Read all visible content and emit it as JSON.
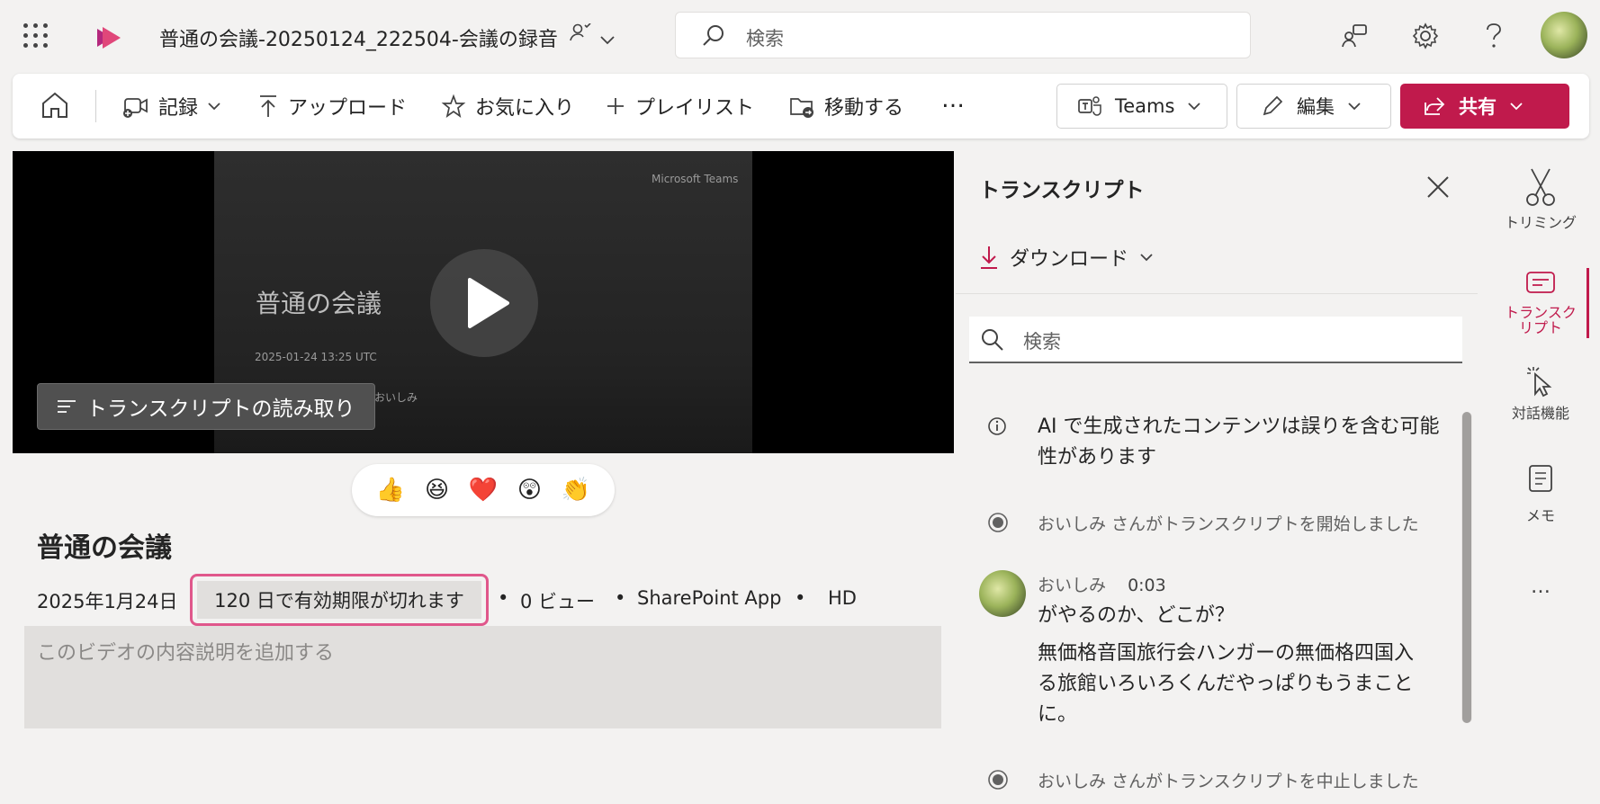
{
  "app": {
    "title": "普通の会議-20250124_222504-会議の録音",
    "search_placeholder": "検索",
    "brand_color": "#c01a4c"
  },
  "toolbar": {
    "record": "記録",
    "upload": "アップロード",
    "favorite": "お気に入り",
    "playlist": "プレイリスト",
    "move": "移動する",
    "more": "…",
    "teams": "Teams",
    "edit": "編集",
    "share": "共有"
  },
  "video": {
    "slide_brand": "Microsoft Teams",
    "slide_title": "普通の会議",
    "slide_date": "2025-01-24 13:25 UTC",
    "slide_organizer": "おいしみ",
    "transcript_button": "トランスクリプトの読み取り",
    "reactions": [
      "👍",
      "😆",
      "❤️",
      "😲",
      "👏"
    ]
  },
  "details": {
    "title": "普通の会議",
    "date": "2025年1月24日",
    "expiry": "120 日で有効期限が切れます",
    "views": "0 ビュー",
    "source": "SharePoint App",
    "quality": "HD",
    "separator": "•",
    "description_placeholder": "このビデオの内容説明を追加する"
  },
  "transcript": {
    "title": "トランスクリプト",
    "download": "ダウンロード",
    "search_placeholder": "検索",
    "ai_note": "AI で生成されたコンテンツは誤りを含む可能性があります",
    "started": "おいしみ さんがトランスクリプトを開始しました",
    "speaker": "おいしみ",
    "timestamp": "0:03",
    "line1": "がやるのか、どこが？",
    "line2": "無価格音国旅行会ハンガーの無価格四国入る旅館いろいろくんだやっぱりもうまことに。",
    "stopped": "おいしみ さんがトランスクリプトを中止しました"
  },
  "rail": {
    "trim": "トリミング",
    "transcript": "トランスクリプト",
    "interactive": "対話機能",
    "notes": "メモ",
    "more": "…"
  }
}
